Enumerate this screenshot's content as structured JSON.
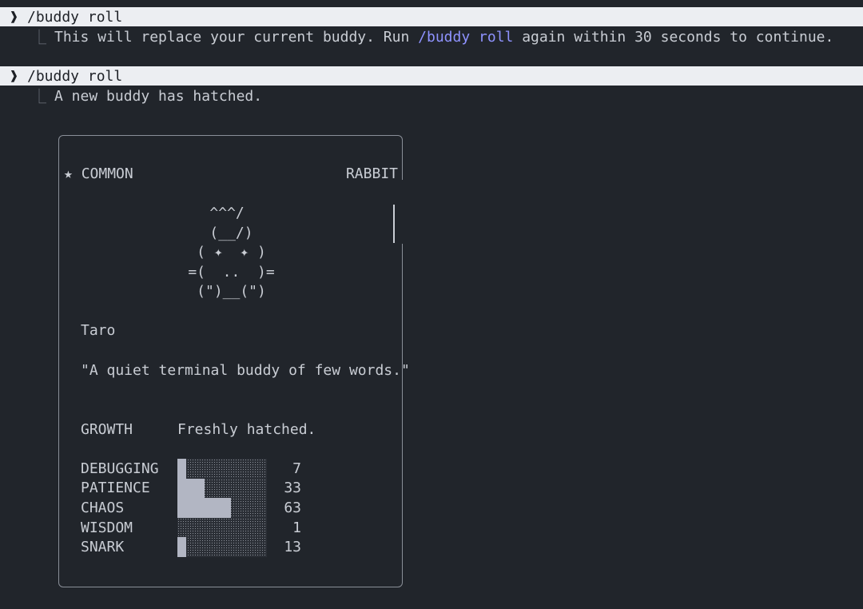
{
  "session": {
    "entries": [
      {
        "prompt_glyph": "❱",
        "command": "/buddy roll",
        "branch_glyph": "⎿",
        "response": {
          "before": "This will replace your current buddy. Run ",
          "highlight": "/buddy roll",
          "after": " again within 30 seconds to continue."
        }
      },
      {
        "prompt_glyph": "❱",
        "command": "/buddy roll",
        "branch_glyph": "⎿",
        "response": {
          "text": "A new buddy has hatched."
        }
      }
    ]
  },
  "card": {
    "rarity_icon": "★",
    "rarity": "COMMON",
    "species": "RABBIT",
    "art": [
      "^^^/ ",
      "(__/)",
      "( ✦  ✦ )",
      "=(  ..  )=",
      "(\")__(\")"
    ],
    "name": "Taro",
    "quote": "\"A quiet terminal buddy of few words.\"",
    "growth_label": "GROWTH",
    "growth_value": "Freshly hatched.",
    "stats": [
      {
        "name": "DEBUGGING",
        "value": "7",
        "level": 0.07
      },
      {
        "name": "PATIENCE",
        "value": "33",
        "level": 0.3
      },
      {
        "name": "CHAOS",
        "value": "63",
        "level": 0.6
      },
      {
        "name": "WISDOM",
        "value": "1",
        "level": 0.0
      },
      {
        "name": "SNARK",
        "value": "13",
        "level": 0.1
      }
    ]
  },
  "colors": {
    "background": "#21252b",
    "command_bar": "#eceef2",
    "accent": "#8f93ff",
    "text": "#c9cdd4",
    "bar_fill": "#b2b6c3"
  }
}
